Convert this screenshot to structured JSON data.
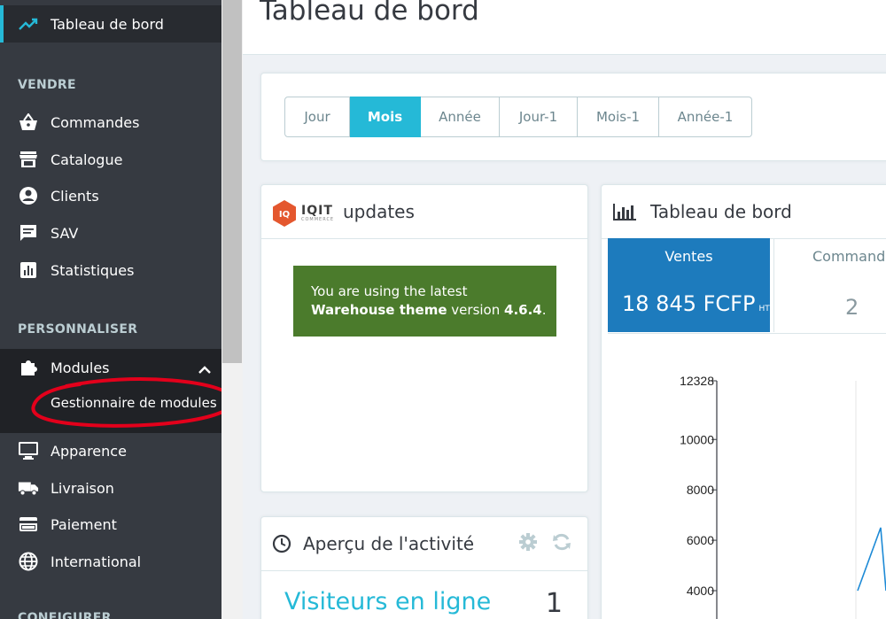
{
  "sidebar": {
    "dashboard": "Tableau de bord",
    "sections": {
      "sell": "VENDRE",
      "customize": "PERSONNALISER",
      "configure": "CONFIGURER"
    },
    "items": {
      "orders": "Commandes",
      "catalog": "Catalogue",
      "customers": "Clients",
      "service": "SAV",
      "stats": "Statistiques",
      "modules": "Modules",
      "module_manager": "Gestionnaire de modules",
      "appearance": "Apparence",
      "shipping": "Livraison",
      "payment": "Paiement",
      "international": "International"
    }
  },
  "header": {
    "title": "Tableau de bord"
  },
  "periods": [
    "Jour",
    "Mois",
    "Année",
    "Jour-1",
    "Mois-1",
    "Année-1"
  ],
  "active_period": "Mois",
  "iqit": {
    "logo_text": "IQ",
    "brand": "IQIT",
    "brand_sub": "COMMERCE",
    "title": "updates",
    "message_pre": "You are using the latest",
    "theme_name": "Warehouse theme",
    "message_mid": "version",
    "version": "4.6.4",
    "message_end": "."
  },
  "activity": {
    "title": "Aperçu de l'activité",
    "visitors_label": "Visiteurs en ligne",
    "visitors_value": "1"
  },
  "dashboard": {
    "title": "Tableau de bord",
    "kpi_sales_label": "Ventes",
    "kpi_sales_value": "18 845 FCFP",
    "kpi_sales_suffix": "HT",
    "kpi_orders_label": "Commandes",
    "kpi_orders_value": "2"
  },
  "colors": {
    "accent": "#25b9d7",
    "sales_kpi": "#1d7bbd",
    "iqit_green": "#4b7b2c",
    "highlight_circle": "#e3001b"
  },
  "chart_data": {
    "type": "line",
    "y_ticks": [
      "12328",
      "10000",
      "8000",
      "6000",
      "4000"
    ],
    "ylim": [
      4000,
      12328
    ],
    "series": [
      {
        "values": [
          4000,
          6500,
          4000
        ]
      }
    ]
  }
}
